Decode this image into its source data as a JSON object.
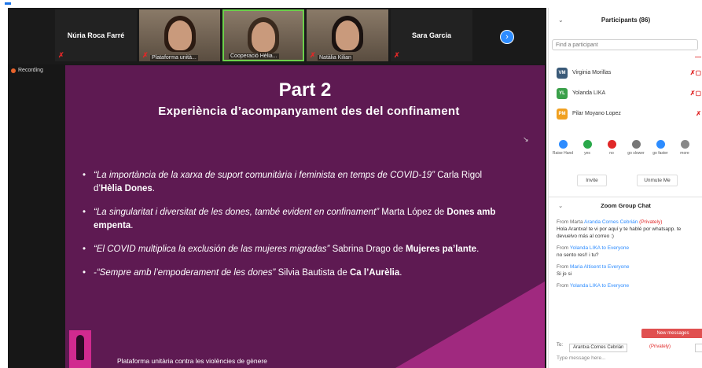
{
  "gallery": {
    "tiles": [
      {
        "name": "Núria Roca Farré",
        "label": ""
      },
      {
        "name": "",
        "label": "Plataforma unità..."
      },
      {
        "name": "",
        "label": "Cooperació Hèlia..."
      },
      {
        "name": "",
        "label": "Natàlia Kilian"
      },
      {
        "name": "Sara Garcia",
        "label": ""
      }
    ]
  },
  "recording": "Recording",
  "slide": {
    "title": "Part 2",
    "subtitle": "Experiència d’acompanyament des del confinament",
    "bullets": [
      {
        "quote": "“La importància de la xarxa de suport comunitària i feminista en temps de COVID-19”",
        "by": " Carla Rigol d’",
        "org": "Hèlia Dones",
        "end": "."
      },
      {
        "quote": "“La singularitat i diversitat de les dones, també evident en confinament”",
        "by": " Marta López de ",
        "org": "Dones amb empenta",
        "end": "."
      },
      {
        "quote": "“El COVID multiplica la exclusión de las mujeres migradas”",
        "by": " Sabrina Drago de ",
        "org": "Mujeres pa’lante",
        "end": "."
      },
      {
        "quote": "-“Sempre amb l’empoderament de les dones”",
        "by": " Silvia Bautista de ",
        "org": "Ca l’Aurèlia",
        "end": "."
      }
    ],
    "footer": "Plataforma unitària contra les violències de gènere"
  },
  "participants": {
    "title": "Participants (86)",
    "search_placeholder": "Find a participant",
    "list": [
      {
        "initials": "VM",
        "name": "Virginia Morillas",
        "color": "#3a5a78"
      },
      {
        "initials": "YL",
        "name": "Yolanda LIKA",
        "color": "#3aa04a"
      },
      {
        "initials": "PM",
        "name": "Pilar Moyano Lopez",
        "color": "#f0a020"
      }
    ],
    "reactions": [
      {
        "label": "Raise Hand",
        "color": "#2d8cff"
      },
      {
        "label": "yes",
        "color": "#2aa84a"
      },
      {
        "label": "no",
        "color": "#e02828"
      },
      {
        "label": "go slower",
        "color": "#777777"
      },
      {
        "label": "go faster",
        "color": "#2d8cff"
      },
      {
        "label": "more",
        "color": "#888888"
      }
    ],
    "invite": "Invite",
    "unmute_me": "Unmute Me"
  },
  "chat": {
    "title": "Zoom Group Chat",
    "messages": [
      {
        "from_prefix": "From Marta ",
        "who": "Aranda Cornes Cebrián",
        "suffix": " ",
        "priv": "(Privately)",
        "text": "Hola Arantxa! te vi por aquí y te hablé por whatsapp. te devuelvo más al correo :)"
      },
      {
        "from_prefix": "From ",
        "who": "Yolanda LIKA to Everyone",
        "suffix": "",
        "priv": "",
        "text": "no sento res!! i tu?"
      },
      {
        "from_prefix": "From ",
        "who": "Maria Altisent to Everyone",
        "suffix": "",
        "priv": "",
        "text": "Si jo si"
      },
      {
        "from_prefix": "From ",
        "who": "Yolanda LIKA to Everyone",
        "suffix": "",
        "priv": "",
        "text": ""
      }
    ],
    "new_messages": "New messages",
    "to_label": "To:",
    "to_value": "Arantxa Cornes Cebrián",
    "to_privately": "(Privately)",
    "type_placeholder": "Type message here..."
  }
}
